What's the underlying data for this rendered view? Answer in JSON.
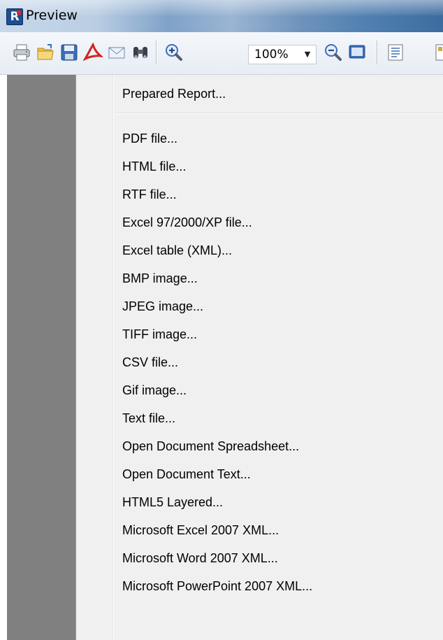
{
  "window": {
    "title": "Preview",
    "app_icon_letter": "R"
  },
  "toolbar": {
    "buttons": [
      {
        "name": "print",
        "icon": "printer-icon"
      },
      {
        "name": "open",
        "icon": "open-folder-icon"
      },
      {
        "name": "save",
        "icon": "floppy-disk-icon"
      },
      {
        "name": "export-pdf",
        "icon": "pdf-icon"
      },
      {
        "name": "email",
        "icon": "envelope-icon"
      },
      {
        "name": "find",
        "icon": "binoculars-icon"
      },
      {
        "name": "zoom-in",
        "icon": "zoom-in-icon"
      },
      {
        "name": "zoom-out",
        "icon": "zoom-out-icon"
      },
      {
        "name": "full-screen",
        "icon": "monitor-icon"
      },
      {
        "name": "outline",
        "icon": "page-outline-icon"
      }
    ],
    "zoom_value": "100%",
    "zoom_arrow": "▼"
  },
  "save_menu": {
    "first_item": "Prepared Report...",
    "items": [
      "PDF file...",
      "HTML file...",
      "RTF file...",
      "Excel 97/2000/XP file...",
      "Excel table (XML)...",
      "BMP image...",
      "JPEG image...",
      "TIFF image...",
      "CSV file...",
      "Gif image...",
      "Text file...",
      "Open Document Spreadsheet...",
      "Open Document Text...",
      "HTML5 Layered...",
      "Microsoft Excel 2007 XML...",
      "Microsoft Word 2007 XML...",
      "Microsoft PowerPoint 2007 XML..."
    ]
  },
  "colors": {
    "menu_background": "#f0f0f0",
    "preview_background": "#808080",
    "titlebar_accent": "#4f7eaf"
  }
}
